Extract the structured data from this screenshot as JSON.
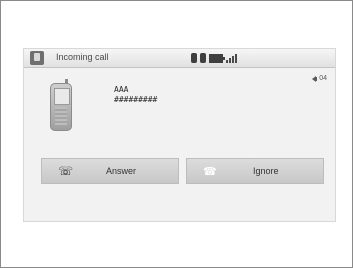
{
  "status_bar": {
    "title": "Incoming call",
    "icons": [
      "phone-icon",
      "bluetooth-icon",
      "battery-icon",
      "signal-icon"
    ]
  },
  "volume": {
    "label": "04",
    "icon": "speaker-icon"
  },
  "caller": {
    "name": "AAA",
    "number": "#########",
    "icon": "mobile-phone-icon"
  },
  "buttons": {
    "answer": {
      "label": "Answer",
      "icon": "answer-phone-icon"
    },
    "ignore": {
      "label": "Ignore",
      "icon": "ignore-phone-icon"
    }
  }
}
